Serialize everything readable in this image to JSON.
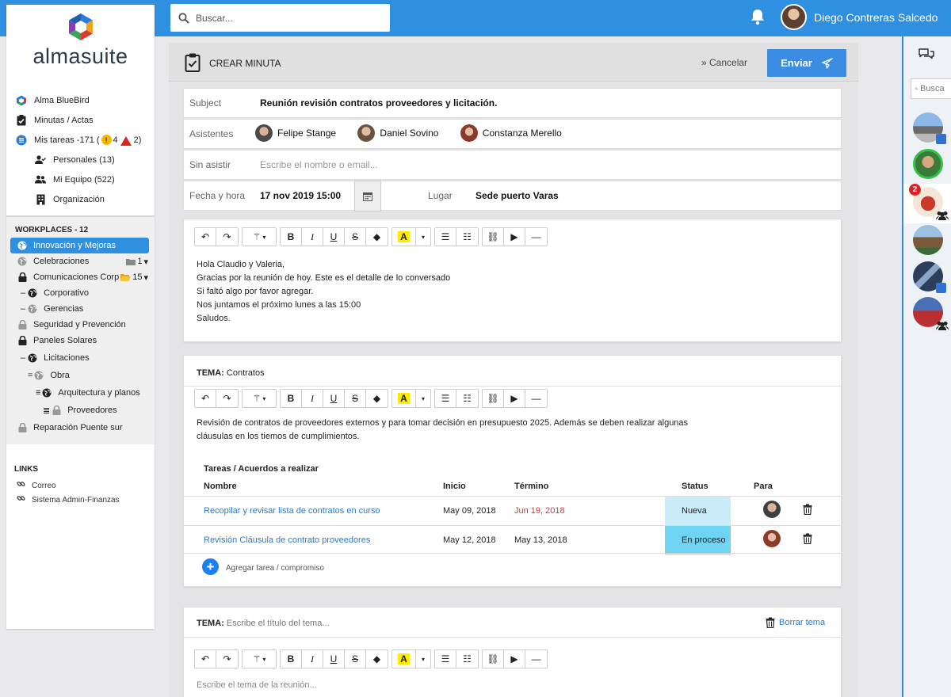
{
  "topbar": {
    "search_placeholder": "Buscar...",
    "user_name": "Diego Contreras Salcedo"
  },
  "sidebar": {
    "logo_text": "almasuite",
    "nav": [
      {
        "label": "Alma BlueBird",
        "icon": "almabird-logo-icon"
      },
      {
        "label": "Minutas / Actas",
        "icon": "clipboard-check-icon"
      },
      {
        "label": "Mis tareas -171 (",
        "icon": "tasks-icon",
        "warn_count": "4",
        "alert_count": "2)"
      },
      {
        "label": "Personales (13)",
        "icon": "user-check-icon"
      },
      {
        "label": "Mi Equipo (522)",
        "icon": "users-icon"
      },
      {
        "label": "Organización",
        "icon": "building-icon"
      }
    ],
    "workplaces_title": "WORKPLACES - 12",
    "workplaces": [
      {
        "label": "Innovación y Mejoras",
        "icon": "globe-icon",
        "active": true
      },
      {
        "label": "Celebraciones",
        "icon": "globe-icon",
        "folder_count": "1"
      },
      {
        "label": "Comunicaciones Corp",
        "icon": "lock-icon",
        "folder_count": "15"
      },
      {
        "label": "Corporativo",
        "icon": "globe-icon",
        "prefix": "–"
      },
      {
        "label": "Gerencias",
        "icon": "globe-icon",
        "prefix": "–"
      },
      {
        "label": "Seguridad y Prevención",
        "icon": "lock-icon"
      },
      {
        "label": "Paneles Solares",
        "icon": "lock-icon"
      },
      {
        "label": "Licitaciones",
        "icon": "globe-icon",
        "prefix": "–"
      },
      {
        "label": "Obra",
        "icon": "globe-icon",
        "prefix": "="
      },
      {
        "label": "Arquitectura y planos",
        "icon": "globe-icon",
        "prefix": "≡"
      },
      {
        "label": "Proveedores",
        "icon": "lock-icon",
        "prefix": "≣"
      },
      {
        "label": "Reparación Puente sur",
        "icon": "lock-icon"
      }
    ],
    "links_title": "LINKS",
    "links": [
      "Correo",
      "Sistema Admin-Finanzas"
    ]
  },
  "header": {
    "title": "CREAR MINUTA",
    "cancel_label": "» Cancelar",
    "send_label": "Enviar"
  },
  "form": {
    "subject_label": "Subject",
    "subject_value": "Reunión revisión contratos proveedores y licitación.",
    "attendees_label": "Asistentes",
    "attendees": [
      "Felipe Stange",
      "Daniel Sovino",
      "Constanza Merello"
    ],
    "absent_label": "Sin asistir",
    "absent_placeholder": "Escribe el nombre o email...",
    "datetime_label": "Fecha y hora",
    "datetime_value": "17 nov 2019  15:00",
    "place_label": "Lugar",
    "place_value": "Sede puerto Varas"
  },
  "intro_editor": {
    "lines": [
      "Hola Claudio y Valeria,",
      "Gracias por la reunión de hoy. Este es el detalle de lo conversado",
      "Si faltó algo por favor agregar.",
      "Nos juntamos el próximo lunes a las 15:00",
      "Saludos."
    ]
  },
  "tema1": {
    "prefix": "TEMA:",
    "title": "Contratos",
    "body_lines": [
      "Revisión de contratos de proveedores externos y para tomar decisión en presupuesto 2025. Además se deben realizar algunas",
      "cláusulas en los tiemos de cumplimientos."
    ],
    "tasks_title": "Tareas / Acuerdos a realizar",
    "columns": [
      "Nombre",
      "Inicio",
      "Término",
      "Status",
      "Para"
    ],
    "tasks": [
      {
        "name": "Recopilar y revisar lista de contratos en curso",
        "start": "May 09, 2018",
        "end": "Jun 19, 2018",
        "status": "Nueva"
      },
      {
        "name": "Revisión Cláusula de contrato proveedores",
        "start": "May 12, 2018",
        "end": "May 13, 2018",
        "status": "En proceso"
      }
    ],
    "add_task_label": "Agregar tarea / compromiso"
  },
  "tema2": {
    "prefix": "TEMA:",
    "title_placeholder": "Escribe el título del tema...",
    "delete_label": "Borrar tema",
    "body_placeholder": "Escribe el tema de la reunión..."
  },
  "rail": {
    "search_placeholder": "Busca",
    "unread_count": "2"
  },
  "colors": {
    "topbar": "#2f8fe0",
    "send_button": "#3a8de3",
    "status_new": "#c9ecf8",
    "status_progress": "#6fd3f2",
    "late_date": "#e03030"
  }
}
